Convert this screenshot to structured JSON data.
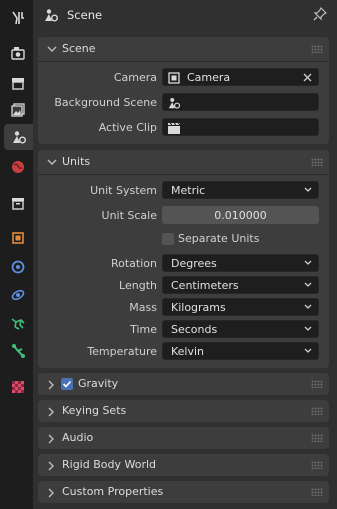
{
  "header": {
    "title": "Scene"
  },
  "tabs": [
    {
      "icon": "tool-icon"
    },
    {
      "icon": "render-icon"
    },
    {
      "icon": "output-icon"
    },
    {
      "icon": "view-layer-icon"
    },
    {
      "icon": "scene-icon",
      "active": true
    },
    {
      "icon": "world-icon"
    },
    {
      "icon": "collection-icon"
    },
    {
      "icon": "object-icon"
    },
    {
      "icon": "modifier-icon"
    },
    {
      "icon": "particles-icon"
    },
    {
      "icon": "physics-icon"
    },
    {
      "icon": "constraints-icon"
    },
    {
      "icon": "data-icon"
    },
    {
      "icon": "texture-icon"
    }
  ],
  "scene_panel": {
    "title": "Scene",
    "camera_label": "Camera",
    "camera_value": "Camera",
    "background_scene_label": "Background Scene",
    "active_clip_label": "Active Clip"
  },
  "units_panel": {
    "title": "Units",
    "unit_system_label": "Unit System",
    "unit_system_value": "Metric",
    "unit_scale_label": "Unit Scale",
    "unit_scale_value": "0.010000",
    "separate_units_label": "Separate Units",
    "rotation_label": "Rotation",
    "rotation_value": "Degrees",
    "length_label": "Length",
    "length_value": "Centimeters",
    "mass_label": "Mass",
    "mass_value": "Kilograms",
    "time_label": "Time",
    "time_value": "Seconds",
    "temperature_label": "Temperature",
    "temperature_value": "Kelvin"
  },
  "collapsed_panels": {
    "gravity": "Gravity",
    "keying_sets": "Keying Sets",
    "audio": "Audio",
    "rigid_body_world": "Rigid Body World",
    "custom_properties": "Custom Properties"
  },
  "colors": {
    "accent": "#4772b3",
    "panel": "#3d3d3d",
    "editor_bg": "#303030",
    "field_bg": "#1e1e1e"
  }
}
